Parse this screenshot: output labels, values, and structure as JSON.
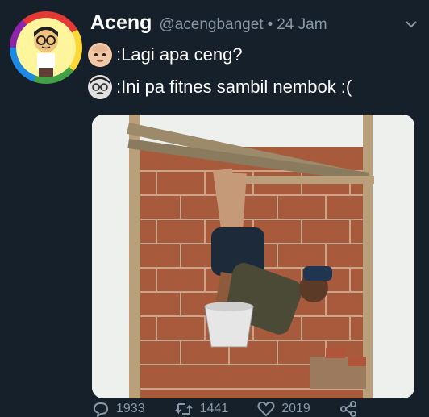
{
  "tweet": {
    "display_name": "Aceng",
    "handle": "@acengbanget",
    "separator": "•",
    "time": "24 Jam",
    "lines": [
      {
        "text": ":Lagi apa ceng?",
        "emoji": "baby-face-icon"
      },
      {
        "text": ":Ini pa fitnes sambil nembok :(",
        "emoji": "cartoon-glasses-face-icon"
      }
    ],
    "media": {
      "icon": "photo-wall-exercise"
    },
    "actions": {
      "reply_count": "1933",
      "retweet_count": "1441",
      "like_count": "2019"
    }
  },
  "colors": {
    "background": "#15202b",
    "text": "#ffffff",
    "muted": "#8899a6"
  }
}
